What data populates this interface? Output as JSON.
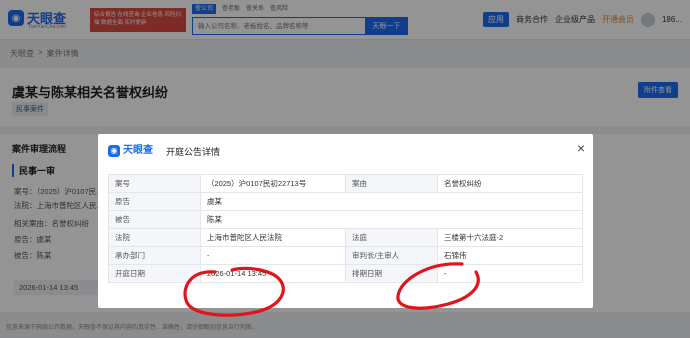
{
  "header": {
    "logo_text": "天眼查",
    "logo_sub": "TianYanCha.com",
    "promo_text": "综合报告 在线查询 企业信息 风险扫描 数据全面 实时更新",
    "search_tabs": [
      "查公司",
      "查老板",
      "查关系",
      "查风险"
    ],
    "search_placeholder": "输入公司名称、老板姓名、品牌名称等",
    "search_button": "天眼一下",
    "nav": {
      "app": "应用",
      "business": "商务合作",
      "products": "企业级产品",
      "vip": "开通会员",
      "user": "186..."
    }
  },
  "breadcrumb": [
    "天眼查",
    ">",
    "案件详情"
  ],
  "case": {
    "title": "虞某与陈某相关名誉权纠纷",
    "tag": "民事案件",
    "attach_button": "附件查看"
  },
  "process": {
    "title": "案件审理流程",
    "stage": "民事一审",
    "lines": [
      "案号：（2025）沪0107民...",
      "法院：上海市普陀区人民...",
      "相关案由：名誉权纠纷",
      "原告：虞某",
      "被告：陈某"
    ],
    "date": "2026-01-14 13:45"
  },
  "footer": "信息来源于网络公开数据，天眼查不保证其内容的真实性、准确性，请仔细甄别信息自行判断。",
  "modal": {
    "logo_text": "天眼查",
    "title": "开庭公告详情",
    "close": "×",
    "rows": [
      [
        {
          "label": "案号",
          "value": "（2025）沪0107民初22713号"
        },
        {
          "label": "案由",
          "value": "名誉权纠纷"
        }
      ],
      [
        {
          "label": "原告",
          "value": "虞某"
        }
      ],
      [
        {
          "label": "被告",
          "value": "陈某"
        }
      ],
      [
        {
          "label": "法院",
          "value": "上海市普陀区人民法院"
        },
        {
          "label": "法庭",
          "value": "三楼第十六法庭-2"
        }
      ],
      [
        {
          "label": "承办部门",
          "value": "-"
        },
        {
          "label": "审判长/主审人",
          "value": "石锦伟"
        }
      ],
      [
        {
          "label": "开庭日期",
          "value": "2026-01-14 13:45"
        },
        {
          "label": "排期日期",
          "value": "-"
        }
      ]
    ]
  }
}
